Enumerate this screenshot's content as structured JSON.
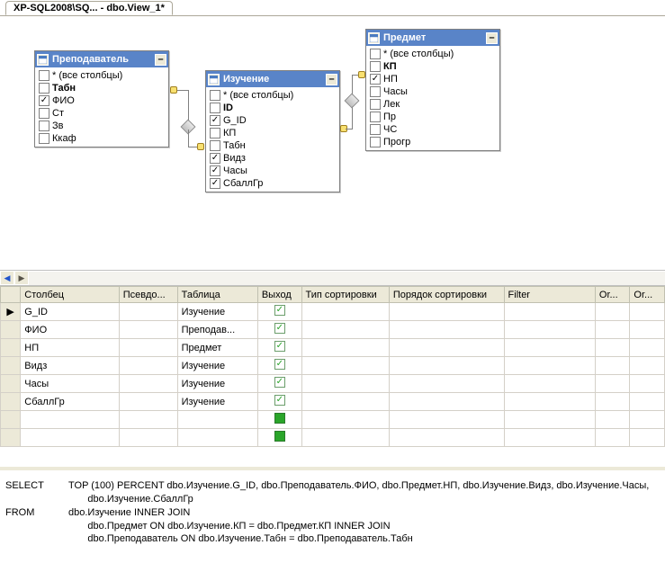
{
  "tab": {
    "label": "XP-SQL2008\\SQ... - dbo.View_1*"
  },
  "tables": {
    "prepod": {
      "title": "Преподаватель",
      "columns": [
        {
          "label": "* (все столбцы)",
          "checked": false,
          "bold": false
        },
        {
          "label": "Табн",
          "checked": false,
          "bold": true
        },
        {
          "label": "ФИО",
          "checked": true,
          "bold": false
        },
        {
          "label": "Ст",
          "checked": false,
          "bold": false
        },
        {
          "label": "Зв",
          "checked": false,
          "bold": false
        },
        {
          "label": "Ккаф",
          "checked": false,
          "bold": false
        }
      ]
    },
    "izuch": {
      "title": "Изучение",
      "columns": [
        {
          "label": "* (все столбцы)",
          "checked": false,
          "bold": false
        },
        {
          "label": "ID",
          "checked": false,
          "bold": true
        },
        {
          "label": "G_ID",
          "checked": true,
          "bold": false
        },
        {
          "label": "КП",
          "checked": false,
          "bold": false
        },
        {
          "label": "Табн",
          "checked": false,
          "bold": false
        },
        {
          "label": "Видз",
          "checked": true,
          "bold": false
        },
        {
          "label": "Часы",
          "checked": true,
          "bold": false
        },
        {
          "label": "СбаллГр",
          "checked": true,
          "bold": false
        }
      ]
    },
    "predmet": {
      "title": "Предмет",
      "columns": [
        {
          "label": "* (все столбцы)",
          "checked": false,
          "bold": false
        },
        {
          "label": "КП",
          "checked": false,
          "bold": true
        },
        {
          "label": "НП",
          "checked": true,
          "bold": false
        },
        {
          "label": "Часы",
          "checked": false,
          "bold": false
        },
        {
          "label": "Лек",
          "checked": false,
          "bold": false
        },
        {
          "label": "Пр",
          "checked": false,
          "bold": false
        },
        {
          "label": "ЧС",
          "checked": false,
          "bold": false
        },
        {
          "label": "Прогр",
          "checked": false,
          "bold": false
        }
      ]
    }
  },
  "gridHeaders": {
    "col": "Столбец",
    "alias": "Псевдо...",
    "table": "Таблица",
    "output": "Выход",
    "sortType": "Тип сортировки",
    "sortOrder": "Порядок сортировки",
    "filter": "Filter",
    "or1": "Or...",
    "or2": "Or..."
  },
  "gridRows": [
    {
      "marker": "▶",
      "col": "G_ID",
      "table": "Изучение",
      "out": "green"
    },
    {
      "marker": "",
      "col": "ФИО",
      "table": "Преподав...",
      "out": "green"
    },
    {
      "marker": "",
      "col": "НП",
      "table": "Предмет",
      "out": "green"
    },
    {
      "marker": "",
      "col": "Видз",
      "table": "Изучение",
      "out": "green"
    },
    {
      "marker": "",
      "col": "Часы",
      "table": "Изучение",
      "out": "green"
    },
    {
      "marker": "",
      "col": "СбаллГр",
      "table": "Изучение",
      "out": "green"
    },
    {
      "marker": "",
      "col": "",
      "table": "",
      "out": "filled"
    },
    {
      "marker": "",
      "col": "",
      "table": "",
      "out": "filled"
    }
  ],
  "sql": {
    "select": "SELECT",
    "selectBody": "TOP (100) PERCENT dbo.Изучение.G_ID, dbo.Преподаватель.ФИО, dbo.Предмет.НП, dbo.Изучение.Видз, dbo.Изучение.Часы,",
    "selectCont": "dbo.Изучение.СбаллГр",
    "from": "FROM",
    "fromBody": "dbo.Изучение INNER JOIN",
    "join1": "dbo.Предмет ON dbo.Изучение.КП = dbo.Предмет.КП INNER JOIN",
    "join2": "dbo.Преподаватель ON dbo.Изучение.Табн = dbo.Преподаватель.Табн"
  }
}
